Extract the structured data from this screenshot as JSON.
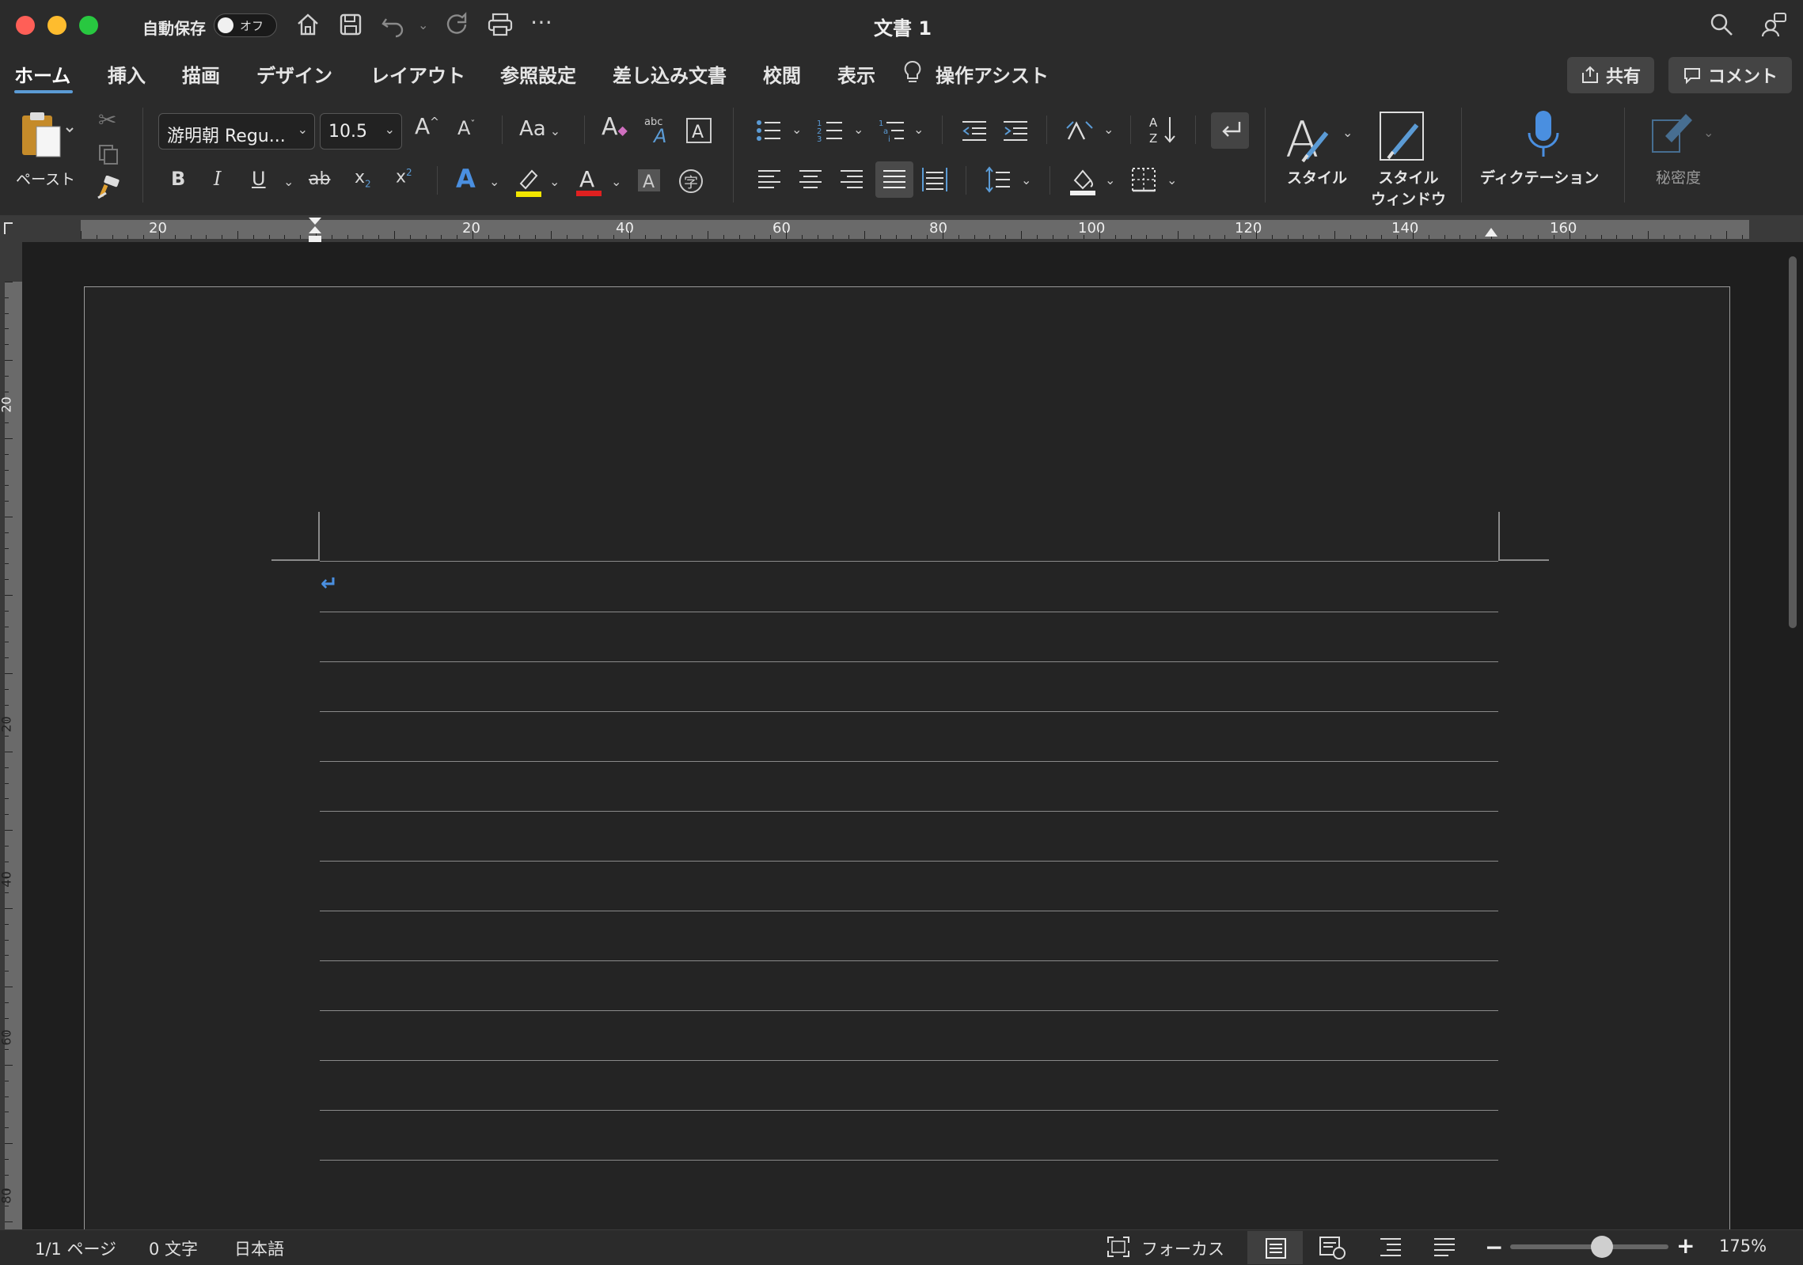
{
  "window": {
    "title": "文書 1",
    "autosave_label": "自動保存",
    "autosave_state": "オフ"
  },
  "tabs": [
    "ホーム",
    "挿入",
    "描画",
    "デザイン",
    "レイアウト",
    "参照設定",
    "差し込み文書",
    "校閲",
    "表示"
  ],
  "tell_me": "操作アシスト",
  "header_buttons": {
    "share": "共有",
    "comment": "コメント"
  },
  "ribbon": {
    "paste_label": "ペースト",
    "font_name": "游明朝 Regu...",
    "font_size": "10.5",
    "change_case": "Aa",
    "bold": "B",
    "italic": "I",
    "underline": "U",
    "strike": "ab",
    "styles_label": "スタイル",
    "styles_pane_label_1": "スタイル",
    "styles_pane_label_2": "ウィンドウ",
    "dictate_label": "ディクテーション",
    "sensitivity_label": "秘密度"
  },
  "ruler": {
    "h_labels": [
      "20",
      "20",
      "40",
      "60",
      "80",
      "100",
      "120",
      "140",
      "160"
    ],
    "v_labels": [
      "20",
      "20",
      "40",
      "60",
      "80"
    ]
  },
  "document": {
    "paragraph_mark": "↵"
  },
  "status": {
    "page": "1/1 ページ",
    "words": "0 文字",
    "language": "日本語",
    "focus": "フォーカス",
    "zoom": "175%"
  },
  "colors": {
    "accent": "#5b9bd5",
    "highlight": "#f2e600",
    "font_color": "#e02020"
  },
  "icons": [
    "home-icon",
    "save-icon",
    "undo-icon",
    "redo-icon",
    "print-icon",
    "more-icon",
    "search-icon",
    "account-icon",
    "lightbulb-icon",
    "share-icon",
    "comment-icon",
    "paste-icon",
    "cut-icon",
    "copy-icon",
    "format-painter-icon",
    "microphone-icon"
  ]
}
